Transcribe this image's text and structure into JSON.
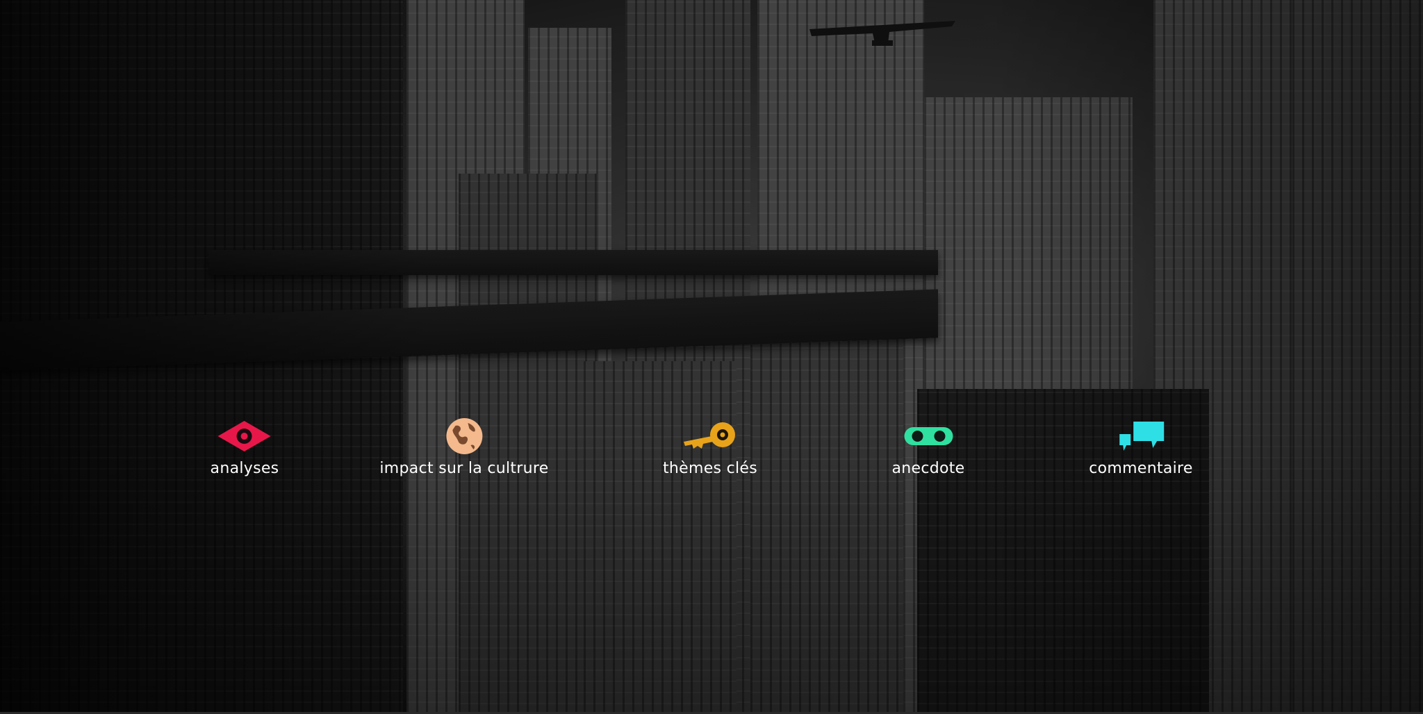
{
  "categories": [
    {
      "label": "analyses",
      "icon": "eye-icon",
      "color": "#e8174a"
    },
    {
      "label": "impact sur la cultrure",
      "icon": "globe-icon",
      "color": "#f4b98c"
    },
    {
      "label": "thèmes clés",
      "icon": "key-icon",
      "color": "#e8a31a"
    },
    {
      "label": "anecdote",
      "icon": "glasses-icon",
      "color": "#2fe0a0"
    },
    {
      "label": "commentaire",
      "icon": "speech-bubbles-icon",
      "color": "#2ee0e6"
    }
  ]
}
